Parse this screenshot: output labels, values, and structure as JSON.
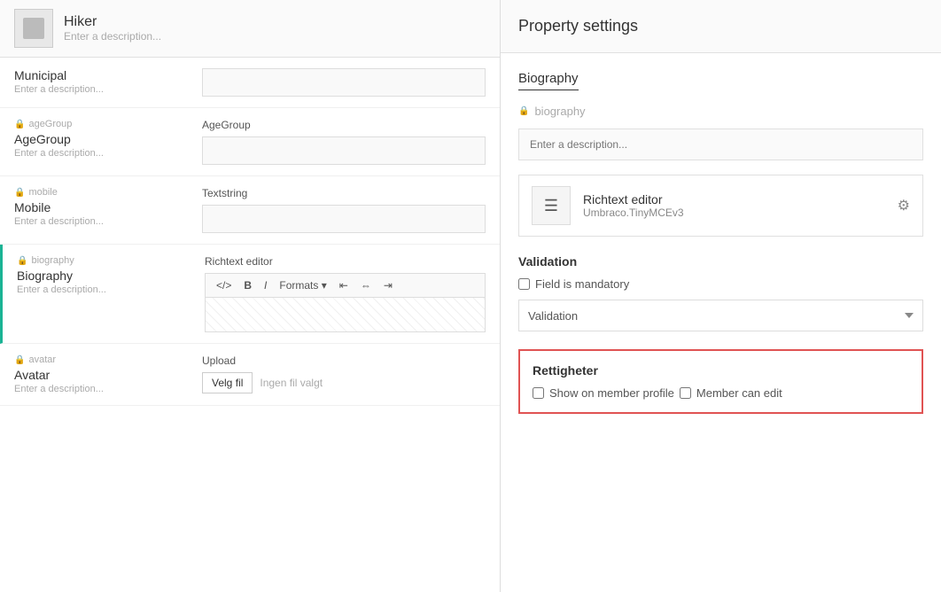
{
  "leftPanel": {
    "header": {
      "name": "Hiker",
      "description": "Enter a description..."
    },
    "properties": [
      {
        "id": "municipal",
        "alias": "Municipal",
        "name": "Municipal",
        "description": "Enter a description...",
        "editorType": "textstring",
        "editorLabel": ""
      },
      {
        "id": "ageGroup",
        "alias": "ageGroup",
        "name": "AgeGroup",
        "description": "Enter a description...",
        "editorType": "textstring",
        "editorLabel": "AgeGroup"
      },
      {
        "id": "mobile",
        "alias": "mobile",
        "name": "Mobile",
        "description": "Enter a description...",
        "editorType": "textstring",
        "editorLabel": "Textstring"
      },
      {
        "id": "biography",
        "alias": "biography",
        "name": "Biography",
        "description": "Enter a description...",
        "editorType": "richtext",
        "editorLabel": "Richtext editor"
      },
      {
        "id": "avatar",
        "alias": "avatar",
        "name": "Avatar",
        "description": "Enter a description...",
        "editorType": "upload",
        "editorLabel": "Upload",
        "uploadBtnLabel": "Velg fil",
        "uploadPlaceholder": "Ingen fil valgt"
      }
    ]
  },
  "rightPanel": {
    "header": {
      "title": "Property settings"
    },
    "sectionTitle": "Biography",
    "fieldAlias": "biography",
    "descriptionPlaceholder": "Enter a description...",
    "editorCard": {
      "name": "Richtext editor",
      "alias": "Umbraco.TinyMCEv3"
    },
    "validation": {
      "sectionLabel": "Validation",
      "mandatoryLabel": "Field is mandatory",
      "dropdownDefault": "Validation"
    },
    "rettigheter": {
      "title": "Rettigheter",
      "showOnProfileLabel": "Show on member profile",
      "memberCanEditLabel": "Member can edit"
    }
  }
}
